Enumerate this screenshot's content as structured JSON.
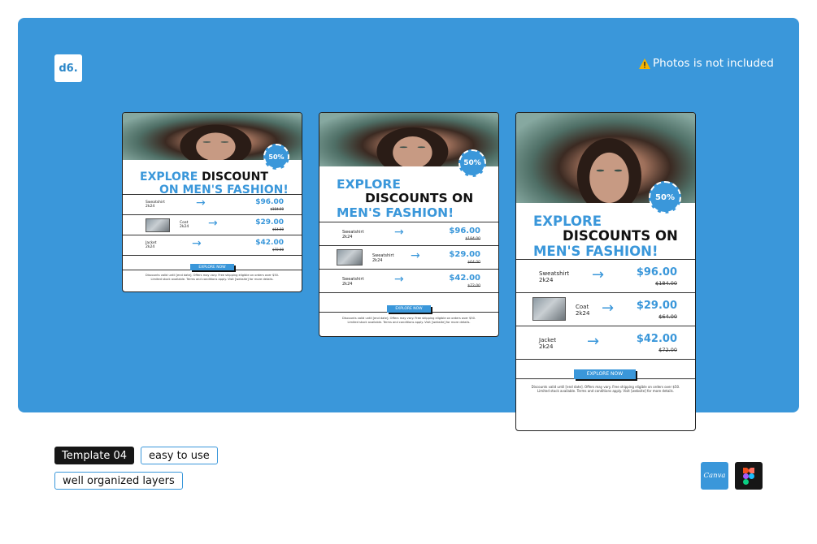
{
  "header": {
    "logo": "d6.",
    "notice": "Photos is not included"
  },
  "templates": [
    {
      "headline_line1_blue": "EXPLORE",
      "headline_line1_dark": "DISCOUNT",
      "headline_line2_blue": "ON MEN'S FASHION!",
      "badge": "50%",
      "products": [
        {
          "name": "Sweatshirt",
          "sub": "2k24",
          "price": "$96.00",
          "old": "$184.00",
          "thumb": false
        },
        {
          "name": "Coat",
          "sub": "2k24",
          "price": "$29.00",
          "old": "$64.00",
          "thumb": true
        },
        {
          "name": "Jacket",
          "sub": "2k24",
          "price": "$42.00",
          "old": "$72.00",
          "thumb": false
        }
      ],
      "cta": "EXPLORE NOW",
      "footer_line1": "Discounts valid until [end date]. Offers may vary. Free shipping eligible on orders over $50.",
      "footer_line2": "Limited stock available. Terms and conditions apply. Visit [website] for more details."
    },
    {
      "headline_line1_blue": "EXPLORE",
      "headline_line2_dark": "DISCOUNTS ON",
      "headline_line3_blue": "MEN'S FASHION!",
      "badge": "50%",
      "products": [
        {
          "name": "Sweatshirt",
          "sub": "2k24",
          "price": "$96.00",
          "old": "$184.00",
          "thumb": false
        },
        {
          "name": "Sweatshirt",
          "sub": "2k24",
          "price": "$29.00",
          "old": "$64.00",
          "thumb": true
        },
        {
          "name": "Sweatshirt",
          "sub": "2k24",
          "price": "$42.00",
          "old": "$72.00",
          "thumb": false
        }
      ],
      "cta": "EXPLORE NOW",
      "footer_line1": "Discounts valid until [end date]. Offers may vary. Free shipping eligible on orders over $50.",
      "footer_line2": "Limited stock available. Terms and conditions apply. Visit [website] for more details."
    },
    {
      "headline_line1_blue": "EXPLORE",
      "headline_line2_dark": "DISCOUNTS ON",
      "headline_line3_blue": "MEN'S FASHION!",
      "badge": "50%",
      "products": [
        {
          "name": "Sweatshirt",
          "sub": "2k24",
          "price": "$96.00",
          "old": "$184.00",
          "thumb": false
        },
        {
          "name": "Coat",
          "sub": "2k24",
          "price": "$29.00",
          "old": "$64.00",
          "thumb": true
        },
        {
          "name": "Jacket",
          "sub": "2k24",
          "price": "$42.00",
          "old": "$72.00",
          "thumb": false
        }
      ],
      "cta": "EXPLORE NOW",
      "footer_line1": "Discounts valid until [end date]. Offers may vary. Free shipping eligible on orders over $50.",
      "footer_line2": "Limited stock available. Terms and conditions apply. Visit [website] for more details."
    }
  ],
  "tags": {
    "template": "Template 04",
    "easy": "easy to use",
    "layers": "well organized layers"
  },
  "apps": {
    "canva": "Canva",
    "figma_icon": "figma-icon"
  },
  "colors": {
    "brand_blue": "#3a97da",
    "dark": "#161616",
    "warning": "#f5b400"
  }
}
